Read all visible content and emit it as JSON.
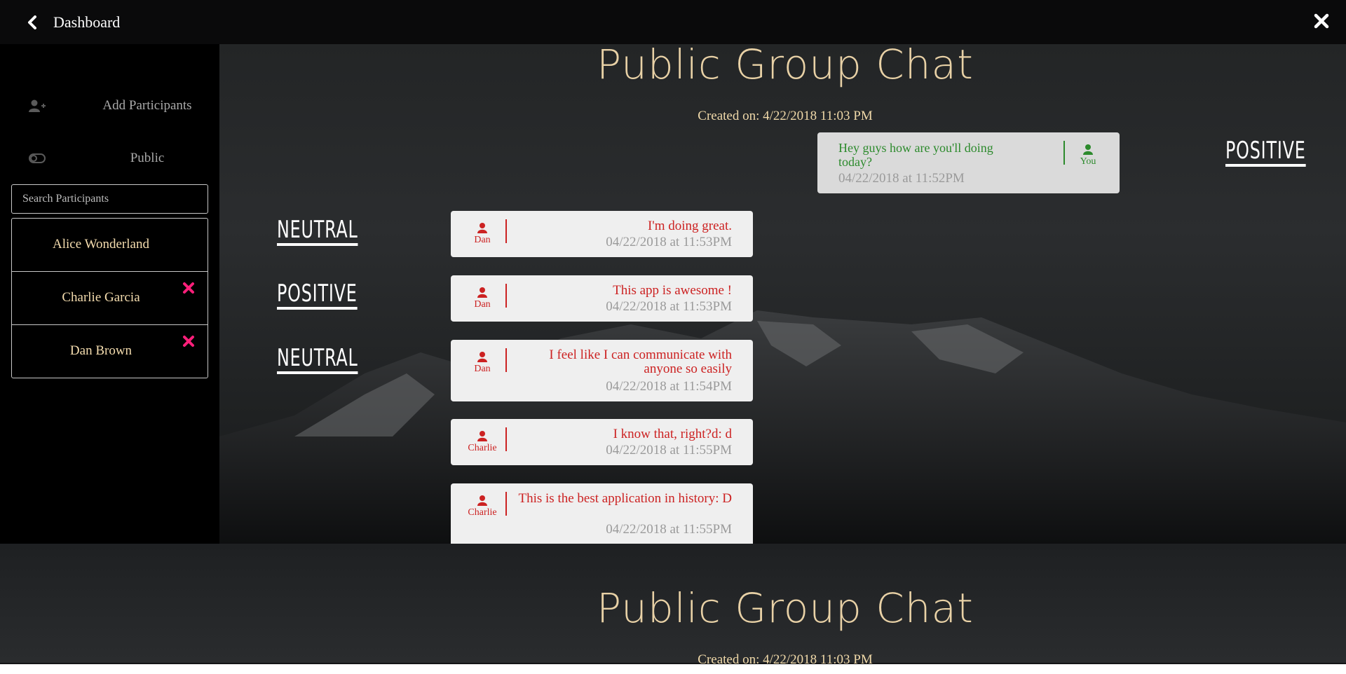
{
  "topbar": {
    "back_label": "Dashboard"
  },
  "sidebar": {
    "add_participants_label": "Add Participants",
    "visibility_label": "Public",
    "search_placeholder": "Search Participants",
    "participants": [
      {
        "name": "Alice Wonderland",
        "removable": false
      },
      {
        "name": "Charlie Garcia",
        "removable": true
      },
      {
        "name": "Dan Brown",
        "removable": true
      }
    ]
  },
  "chat": {
    "title": "Public Group Chat",
    "created": "Created on: 4/22/2018 11:03 PM",
    "messages": [
      {
        "sender": "You",
        "text": "Hey guys how are you'll doing today?",
        "time": "04/22/2018 at 11:52PM",
        "sentiment": "POSITIVE",
        "mine": true
      },
      {
        "sender": "Dan",
        "text": "I'm doing great.",
        "time": "04/22/2018 at 11:53PM",
        "sentiment": "NEUTRAL"
      },
      {
        "sender": "Dan",
        "text": "This app is awesome !",
        "time": "04/22/2018 at 11:53PM",
        "sentiment": "POSITIVE"
      },
      {
        "sender": "Dan",
        "text": "I feel like I can communicate with anyone so easily",
        "time": "04/22/2018 at 11:54PM",
        "sentiment": "NEUTRAL"
      },
      {
        "sender": "Charlie",
        "text": "I know that, right?d: d",
        "time": "04/22/2018 at 11:55PM",
        "sentiment": ""
      },
      {
        "sender": "Charlie",
        "text": "This is the best application in history: D",
        "time": "04/22/2018 at 11:55PM",
        "sentiment": ""
      }
    ]
  },
  "footer_preview": {
    "title": "Public Group Chat",
    "created": "Created on: 4/22/2018 11:03 PM"
  },
  "colors": {
    "accent_gold": "#e8d1a6",
    "remove_pink": "#ff1f7a",
    "other_message_red": "#cc2222",
    "own_message_green": "#2c8a2c"
  },
  "icons": {
    "back": "chevron-left-icon",
    "close": "close-icon",
    "add_participants": "user-plus-icon",
    "visibility": "toggle-icon",
    "sender": "user-icon",
    "remove": "remove-x-icon"
  }
}
